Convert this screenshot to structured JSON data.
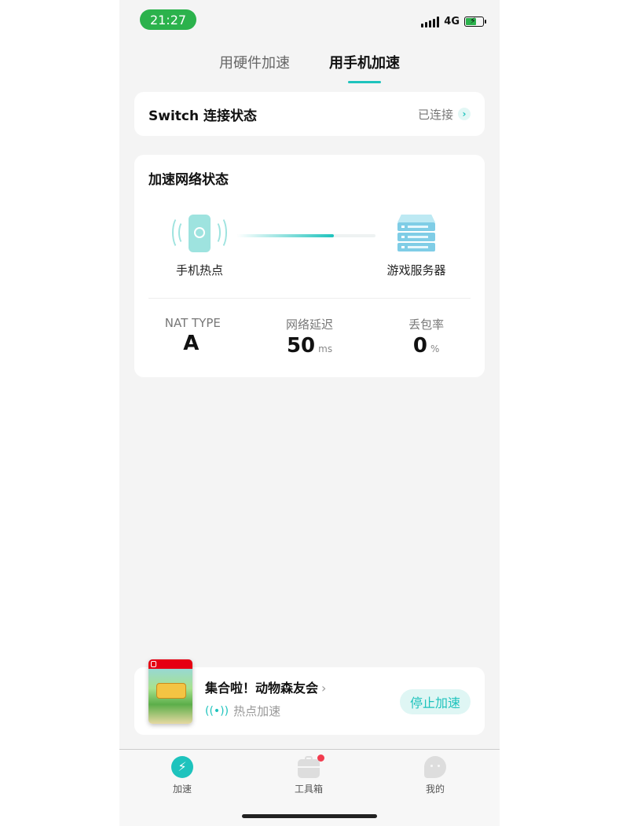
{
  "status_bar": {
    "time": "21:27",
    "network": "4G",
    "battery_level": 0.7
  },
  "tabs": [
    {
      "label": "用硬件加速",
      "active": false
    },
    {
      "label": "用手机加速",
      "active": true
    }
  ],
  "switch_card": {
    "title": "Switch 连接状态",
    "status": "已连接"
  },
  "network_card": {
    "title": "加速网络状态",
    "source_label": "手机热点",
    "target_label": "游戏服务器",
    "link_progress": 0.7,
    "stats": [
      {
        "label": "NAT TYPE",
        "value": "A",
        "unit": ""
      },
      {
        "label": "网络延迟",
        "value": "50",
        "unit": "ms"
      },
      {
        "label": "丢包率",
        "value": "0",
        "unit": "%"
      }
    ]
  },
  "game_card": {
    "title": "集合啦！动物森友会",
    "mode": "热点加速",
    "stop_label": "停止加速"
  },
  "bottom_nav": [
    {
      "label": "加速",
      "icon": "bolt-icon",
      "active": true
    },
    {
      "label": "工具箱",
      "icon": "toolbox-icon",
      "active": false,
      "badge": true
    },
    {
      "label": "我的",
      "icon": "profile-icon",
      "active": false
    }
  ],
  "colors": {
    "accent": "#1ec3bd",
    "status_green": "#2bb24c",
    "badge_red": "#f23c4f"
  }
}
